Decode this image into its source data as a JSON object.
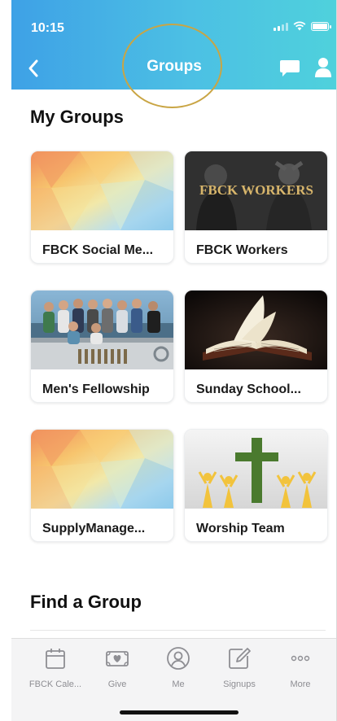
{
  "status_bar": {
    "time": "10:15"
  },
  "nav": {
    "title": "Groups"
  },
  "my_groups": {
    "heading": "My Groups",
    "groups": [
      {
        "label": "FBCK Social Me...",
        "thumb": "polygon-gradient"
      },
      {
        "label": "FBCK Workers",
        "thumb": "photo-workers",
        "overlay_text": "FBCK WORKERS"
      },
      {
        "label": "Men's Fellowship",
        "thumb": "photo-fishing-group"
      },
      {
        "label": "Sunday School...",
        "thumb": "photo-open-bible"
      },
      {
        "label": "SupplyManage...",
        "thumb": "polygon-gradient"
      },
      {
        "label": "Worship Team",
        "thumb": "cross-and-figures"
      }
    ]
  },
  "find_group": {
    "heading": "Find a Group"
  },
  "tabbar": {
    "tabs": [
      {
        "label": "FBCK Cale...",
        "icon": "calendar-icon"
      },
      {
        "label": "Give",
        "icon": "give-icon"
      },
      {
        "label": "Me",
        "icon": "me-icon"
      },
      {
        "label": "Signups",
        "icon": "signups-icon"
      },
      {
        "label": "More",
        "icon": "more-icon"
      }
    ]
  },
  "colors": {
    "header_start": "#3ea1e6",
    "header_end": "#4fd1dc",
    "highlight_circle": "#c9a544",
    "workers_text": "#d7b56b",
    "cross_green": "#4a7a2e",
    "figure_yellow": "#f2c33c",
    "tab_gray": "#8e8e93"
  }
}
